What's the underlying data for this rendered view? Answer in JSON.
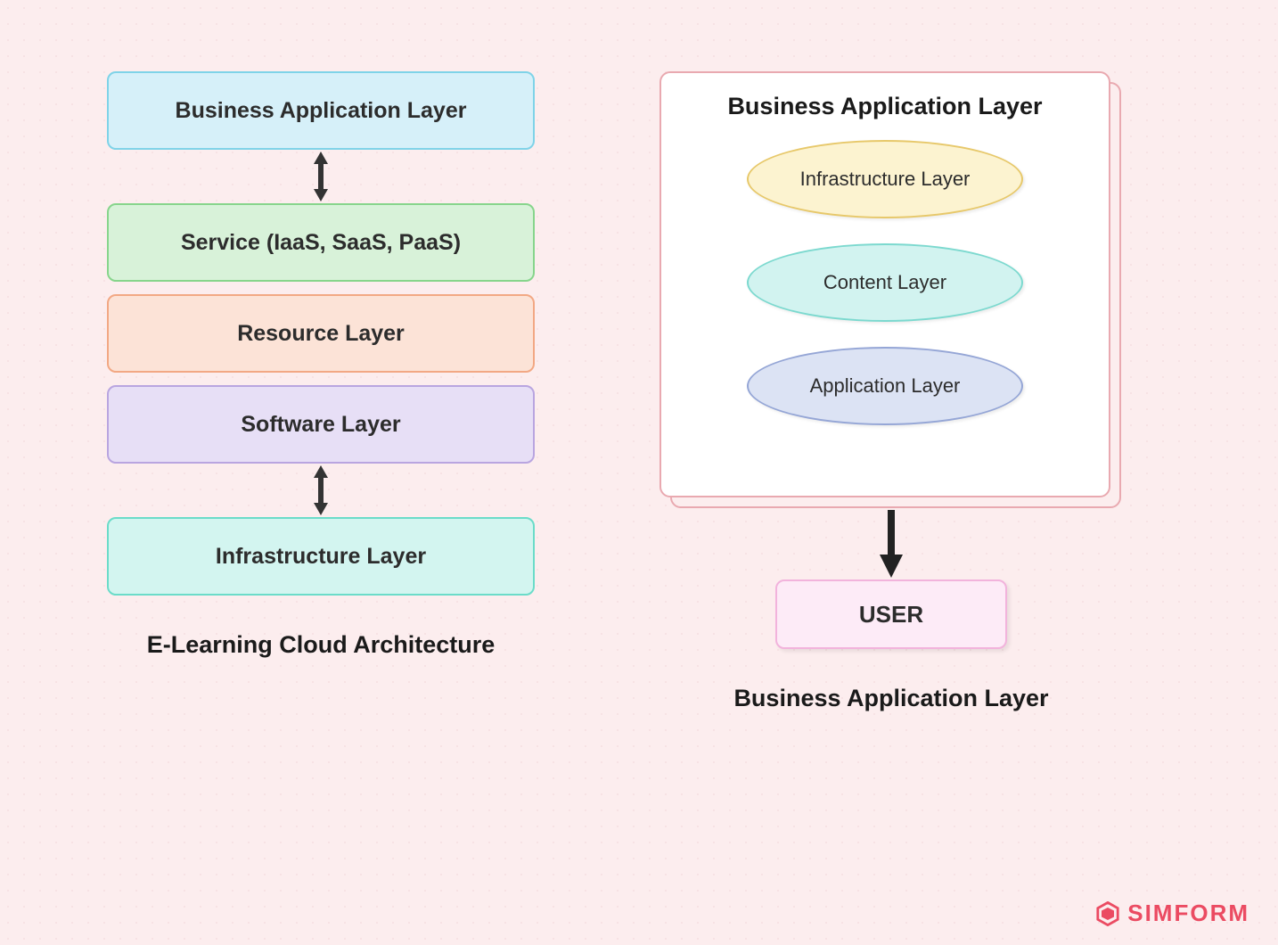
{
  "left": {
    "layers": [
      {
        "label": "Business Application Layer"
      },
      {
        "label": "Service (IaaS, SaaS, PaaS)"
      },
      {
        "label": "Resource Layer"
      },
      {
        "label": "Software Layer"
      },
      {
        "label": "Infrastructure Layer"
      }
    ],
    "caption": "E-Learning Cloud Architecture"
  },
  "right": {
    "card_title": "Business Application Layer",
    "ellipses": [
      {
        "label": "Infrastructure Layer"
      },
      {
        "label": "Content Layer"
      },
      {
        "label": "Application Layer"
      }
    ],
    "user_label": "USER",
    "caption": "Business Application Layer"
  },
  "logo_text": "SIMFORM"
}
